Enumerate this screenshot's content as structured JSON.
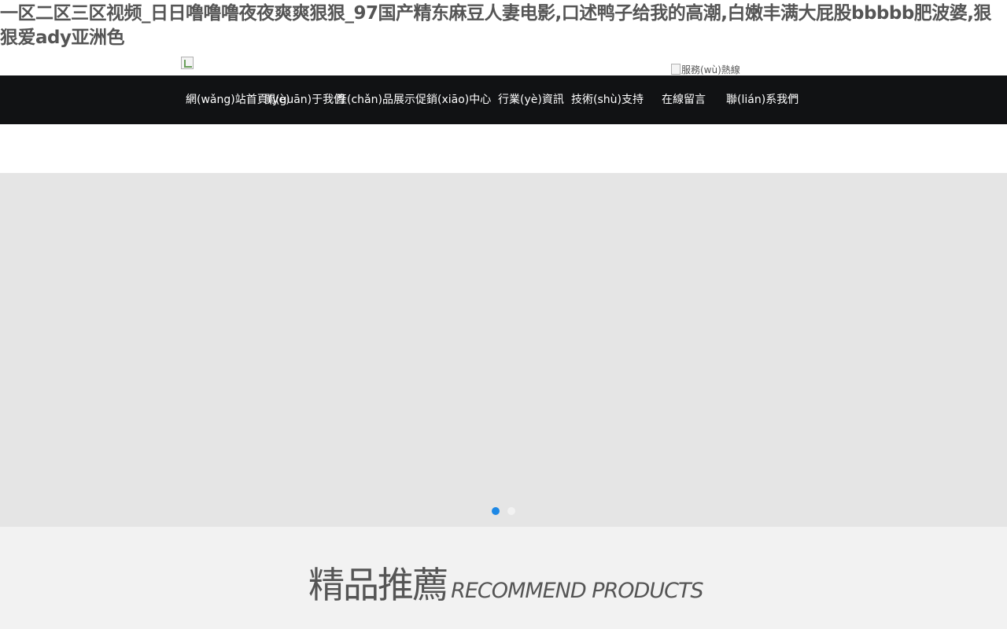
{
  "page": {
    "title": "一区二区三区视频_日日噜噜噜夜夜爽爽狠狠_97国产精东麻豆人妻电影,口述鸭子给我的高潮,白嫩丰满大屁股bbbbb肥波婆,狠狠爱ady亚洲色"
  },
  "header": {
    "hotline_alt": "服務(wù)熱線"
  },
  "nav": {
    "items": [
      {
        "label": "網(wǎng)站首頁(yè)"
      },
      {
        "label": "關(guān)于我們"
      },
      {
        "label": "產(chǎn)品展示"
      },
      {
        "label": "促銷(xiāo)中心"
      },
      {
        "label": "行業(yè)資訊"
      },
      {
        "label": "技術(shù)支持"
      },
      {
        "label": "在線留言"
      },
      {
        "label": "聯(lián)系我們"
      }
    ]
  },
  "banner": {
    "dots": [
      {
        "active": true,
        "color": "#1e88e5"
      },
      {
        "active": false,
        "color": "#f2f2f2"
      }
    ]
  },
  "section": {
    "title_cn": "精品推薦",
    "title_en": "RECOMMEND PRODUCTS"
  },
  "colors": {
    "nav_bg": "#111214",
    "banner_bg": "#e5e5e5",
    "section_bg": "#f2f2f2",
    "text": "#555555",
    "dot_active": "#1e88e5"
  }
}
